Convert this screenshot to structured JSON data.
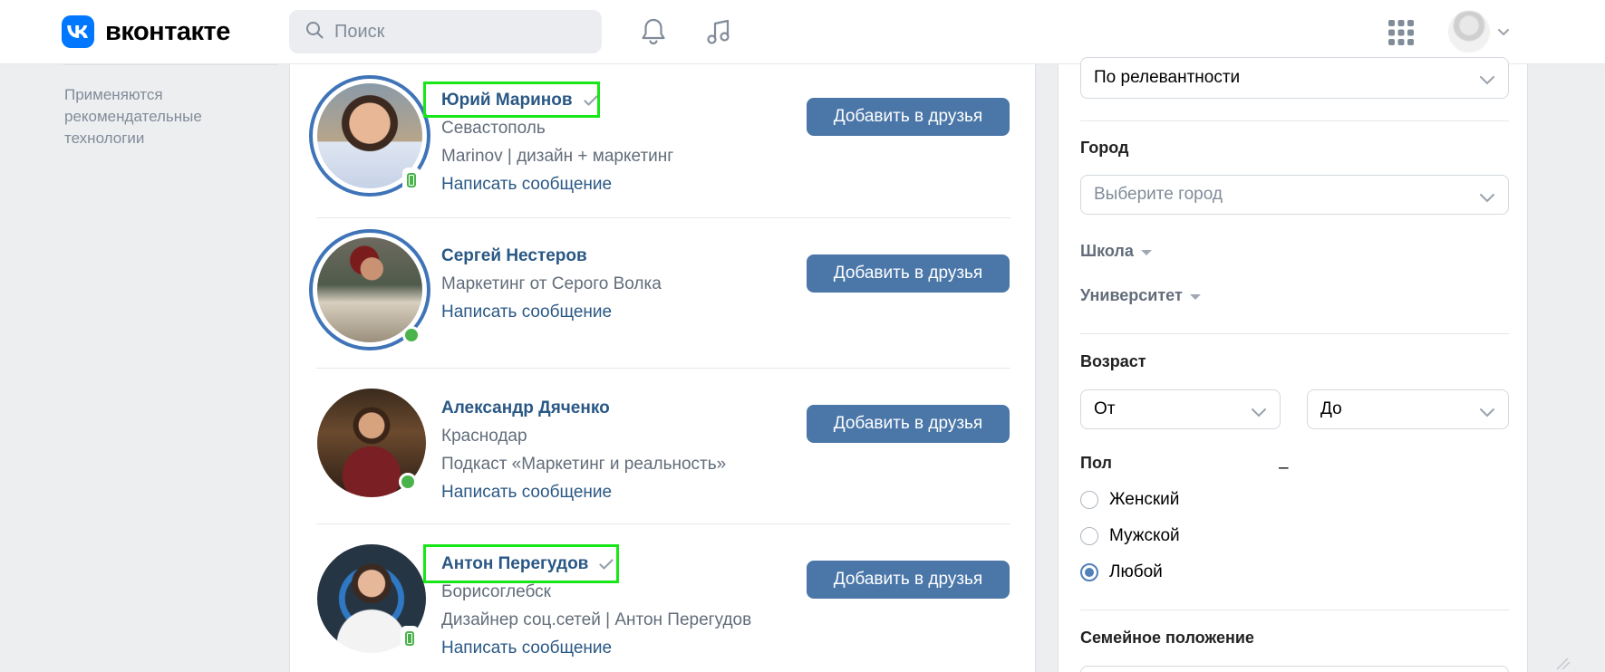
{
  "header": {
    "logo_text": "вконтакте",
    "search_placeholder": "Поиск",
    "icons": [
      "vk-logo-icon",
      "search-icon",
      "bell-icon",
      "music-icon",
      "apps-grid-icon",
      "chevron-down-icon"
    ]
  },
  "sidebar": {
    "note": "Применяются рекомендательные технологии"
  },
  "people": [
    {
      "name": "Юрий Маринов",
      "verified": true,
      "lines": [
        "Севастополь",
        "Marinov | дизайн + маркетинг"
      ],
      "message_link": "Написать сообщение",
      "add_button": "Добавить в друзья",
      "status": "mobile",
      "has_story_ring": true,
      "highlighted": true
    },
    {
      "name": "Сергей Нестеров",
      "verified": false,
      "lines": [
        "Маркетинг от Серого Волка"
      ],
      "message_link": "Написать сообщение",
      "add_button": "Добавить в друзья",
      "status": "online",
      "has_story_ring": true,
      "highlighted": false
    },
    {
      "name": "Александр Дяченко",
      "verified": false,
      "lines": [
        "Краснодар",
        "Подкаст «Маркетинг и реальность»"
      ],
      "message_link": "Написать сообщение",
      "add_button": "Добавить в друзья",
      "status": "online",
      "has_story_ring": false,
      "highlighted": false
    },
    {
      "name": "Антон Перегудов",
      "verified": true,
      "lines": [
        "Борисоглебск",
        "Дизайнер соц.сетей | Антон Перегудов"
      ],
      "message_link": "Написать сообщение",
      "add_button": "Добавить в друзья",
      "status": "mobile",
      "has_story_ring": false,
      "highlighted": true
    }
  ],
  "filters": {
    "sort_value": "По релевантности",
    "city_label": "Город",
    "city_placeholder": "Выберите город",
    "school_label": "Школа",
    "university_label": "Университет",
    "age_label": "Возраст",
    "age_from": "От",
    "age_sep": "–",
    "age_to": "До",
    "gender_label": "Пол",
    "gender_options": [
      "Женский",
      "Мужской",
      "Любой"
    ],
    "gender_selected": "Любой",
    "marital_label": "Семейное положение"
  },
  "colors": {
    "accent": "#4a76a8",
    "link": "#2a5885",
    "online": "#4bb34b",
    "highlight": "#17e617",
    "vk_blue": "#0077ff"
  }
}
